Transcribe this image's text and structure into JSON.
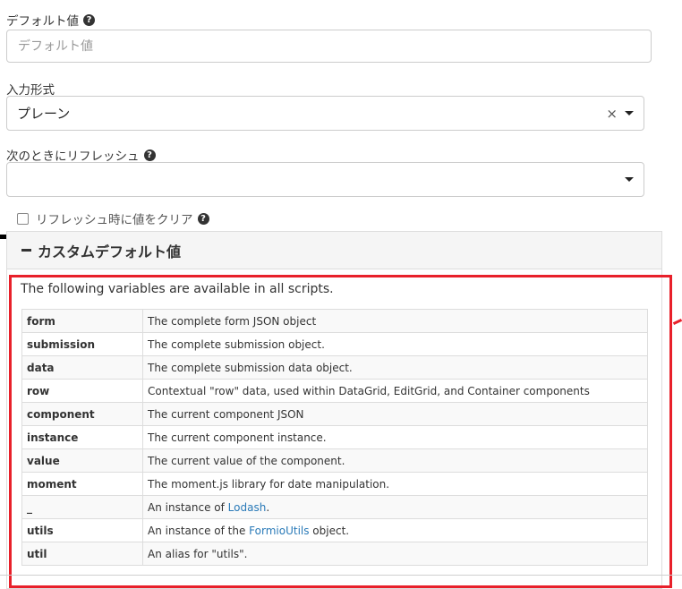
{
  "default_value": {
    "label": "デフォルト値",
    "placeholder": "デフォルト値",
    "help_icon": "question-circle-icon"
  },
  "input_format": {
    "label": "入力形式",
    "selected": "プレーン",
    "clear_glyph": "×"
  },
  "refresh_on": {
    "label": "次のときにリフレッシュ",
    "selected": "",
    "help_icon": "question-circle-icon"
  },
  "clear_on_refresh": {
    "label": "リフレッシュ時に値をクリア",
    "checked": false,
    "help_icon": "question-circle-icon"
  },
  "custom_default_panel": {
    "title": "カスタムデフォルト値",
    "intro": "The following variables are available in all scripts.",
    "variables": [
      {
        "name": "form",
        "description": "The complete form JSON object"
      },
      {
        "name": "submission",
        "description": "The complete submission object."
      },
      {
        "name": "data",
        "description": "The complete submission data object."
      },
      {
        "name": "row",
        "description": "Contextual \"row\" data, used within DataGrid, EditGrid, and Container components"
      },
      {
        "name": "component",
        "description": "The current component JSON"
      },
      {
        "name": "instance",
        "description": "The current component instance."
      },
      {
        "name": "value",
        "description": "The current value of the component."
      },
      {
        "name": "moment",
        "description": "The moment.js library for date manipulation."
      },
      {
        "name": "_",
        "desc_prefix": "An instance of ",
        "desc_link": "Lodash",
        "desc_suffix": "."
      },
      {
        "name": "utils",
        "desc_prefix": "An instance of the ",
        "desc_link": "FormioUtils",
        "desc_suffix": " object."
      },
      {
        "name": "util",
        "description": "An alias for \"utils\"."
      }
    ]
  },
  "colors": {
    "highlight_border": "#e8202a",
    "link": "#2a7ab8"
  }
}
